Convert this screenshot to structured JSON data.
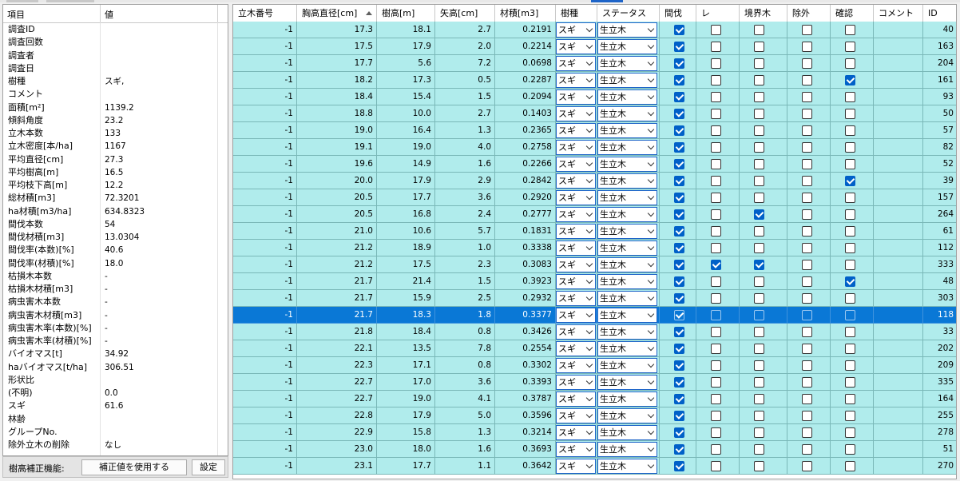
{
  "summary": {
    "header_item": "項目",
    "header_value": "値",
    "rows": [
      {
        "k": "調査ID",
        "v": ""
      },
      {
        "k": "調査回数",
        "v": ""
      },
      {
        "k": "調査者",
        "v": ""
      },
      {
        "k": "調査日",
        "v": ""
      },
      {
        "k": "樹種",
        "v": "スギ,"
      },
      {
        "k": "コメント",
        "v": ""
      },
      {
        "k": "面積[m²]",
        "v": "1139.2"
      },
      {
        "k": "傾斜角度",
        "v": "23.2"
      },
      {
        "k": "立木本数",
        "v": "133"
      },
      {
        "k": "立木密度[本/ha]",
        "v": "1167"
      },
      {
        "k": "平均直径[cm]",
        "v": "27.3"
      },
      {
        "k": "平均樹高[m]",
        "v": "16.5"
      },
      {
        "k": "平均枝下高[m]",
        "v": "12.2"
      },
      {
        "k": "総材積[m3]",
        "v": "72.3201"
      },
      {
        "k": "ha材積[m3/ha]",
        "v": "634.8323"
      },
      {
        "k": "間伐本数",
        "v": "54"
      },
      {
        "k": "間伐材積[m3]",
        "v": "13.0304"
      },
      {
        "k": "間伐率(本数)[%]",
        "v": "40.6"
      },
      {
        "k": "間伐率(材積)[%]",
        "v": "18.0"
      },
      {
        "k": "枯損木本数",
        "v": "-"
      },
      {
        "k": "枯損木材積[m3]",
        "v": "-"
      },
      {
        "k": "病虫害木本数",
        "v": "-"
      },
      {
        "k": "病虫害木材積[m3]",
        "v": "-"
      },
      {
        "k": "病虫害木率(本数)[%]",
        "v": "-"
      },
      {
        "k": "病虫害木率(材積)[%]",
        "v": "-"
      },
      {
        "k": "バイオマス[t]",
        "v": "34.92"
      },
      {
        "k": "haバイオマス[t/ha]",
        "v": "306.51"
      },
      {
        "k": "形状比",
        "v": ""
      },
      {
        "k": "  (不明)",
        "v": "0.0"
      },
      {
        "k": "  スギ",
        "v": "61.6"
      },
      {
        "k": "林齢",
        "v": ""
      },
      {
        "k": "グループNo.",
        "v": ""
      },
      {
        "k": "除外立木の削除",
        "v": "なし"
      }
    ]
  },
  "bottom": {
    "label": "樹高補正機能:",
    "use_corrected_button": "補正値を使用する",
    "settings_button": "設定"
  },
  "grid": {
    "columns": [
      "立木番号",
      "胸高直径[cm]",
      "樹高[m]",
      "矢高[cm]",
      "材積[m3]",
      "樹種",
      "ステータス",
      "間伐",
      "レ",
      "境界木",
      "除外",
      "確認",
      "コメント",
      "ID"
    ],
    "sorted_column": "胸高直径[cm]",
    "rows": [
      {
        "no": "-1",
        "dbh": "17.3",
        "h": "18.1",
        "ya": "2.7",
        "vol": "0.2191",
        "sp": "スギ",
        "st": "生立木",
        "th": true,
        "re": false,
        "bd": false,
        "ex": false,
        "ck": false,
        "id": "40"
      },
      {
        "no": "-1",
        "dbh": "17.5",
        "h": "17.9",
        "ya": "2.0",
        "vol": "0.2214",
        "sp": "スギ",
        "st": "生立木",
        "th": true,
        "re": false,
        "bd": false,
        "ex": false,
        "ck": false,
        "id": "163"
      },
      {
        "no": "-1",
        "dbh": "17.7",
        "h": "5.6",
        "ya": "7.2",
        "vol": "0.0698",
        "sp": "スギ",
        "st": "生立木",
        "th": true,
        "re": false,
        "bd": false,
        "ex": false,
        "ck": false,
        "id": "204"
      },
      {
        "no": "-1",
        "dbh": "18.2",
        "h": "17.3",
        "ya": "0.5",
        "vol": "0.2287",
        "sp": "スギ",
        "st": "生立木",
        "th": true,
        "re": false,
        "bd": false,
        "ex": false,
        "ck": true,
        "id": "161"
      },
      {
        "no": "-1",
        "dbh": "18.4",
        "h": "15.4",
        "ya": "1.5",
        "vol": "0.2094",
        "sp": "スギ",
        "st": "生立木",
        "th": true,
        "re": false,
        "bd": false,
        "ex": false,
        "ck": false,
        "id": "93"
      },
      {
        "no": "-1",
        "dbh": "18.8",
        "h": "10.0",
        "ya": "2.7",
        "vol": "0.1403",
        "sp": "スギ",
        "st": "生立木",
        "th": true,
        "re": false,
        "bd": false,
        "ex": false,
        "ck": false,
        "id": "50"
      },
      {
        "no": "-1",
        "dbh": "19.0",
        "h": "16.4",
        "ya": "1.3",
        "vol": "0.2365",
        "sp": "スギ",
        "st": "生立木",
        "th": true,
        "re": false,
        "bd": false,
        "ex": false,
        "ck": false,
        "id": "57"
      },
      {
        "no": "-1",
        "dbh": "19.1",
        "h": "19.0",
        "ya": "4.0",
        "vol": "0.2758",
        "sp": "スギ",
        "st": "生立木",
        "th": true,
        "re": false,
        "bd": false,
        "ex": false,
        "ck": false,
        "id": "82"
      },
      {
        "no": "-1",
        "dbh": "19.6",
        "h": "14.9",
        "ya": "1.6",
        "vol": "0.2266",
        "sp": "スギ",
        "st": "生立木",
        "th": true,
        "re": false,
        "bd": false,
        "ex": false,
        "ck": false,
        "id": "52"
      },
      {
        "no": "-1",
        "dbh": "20.0",
        "h": "17.9",
        "ya": "2.9",
        "vol": "0.2842",
        "sp": "スギ",
        "st": "生立木",
        "th": true,
        "re": false,
        "bd": false,
        "ex": false,
        "ck": true,
        "id": "39"
      },
      {
        "no": "-1",
        "dbh": "20.5",
        "h": "17.7",
        "ya": "3.6",
        "vol": "0.2920",
        "sp": "スギ",
        "st": "生立木",
        "th": true,
        "re": false,
        "bd": false,
        "ex": false,
        "ck": false,
        "id": "157"
      },
      {
        "no": "-1",
        "dbh": "20.5",
        "h": "16.8",
        "ya": "2.4",
        "vol": "0.2777",
        "sp": "スギ",
        "st": "生立木",
        "th": true,
        "re": false,
        "bd": true,
        "ex": false,
        "ck": false,
        "id": "264"
      },
      {
        "no": "-1",
        "dbh": "21.0",
        "h": "10.6",
        "ya": "5.7",
        "vol": "0.1831",
        "sp": "スギ",
        "st": "生立木",
        "th": true,
        "re": false,
        "bd": false,
        "ex": false,
        "ck": false,
        "id": "61"
      },
      {
        "no": "-1",
        "dbh": "21.2",
        "h": "18.9",
        "ya": "1.0",
        "vol": "0.3338",
        "sp": "スギ",
        "st": "生立木",
        "th": true,
        "re": false,
        "bd": false,
        "ex": false,
        "ck": false,
        "id": "112"
      },
      {
        "no": "-1",
        "dbh": "21.2",
        "h": "17.5",
        "ya": "2.3",
        "vol": "0.3083",
        "sp": "スギ",
        "st": "生立木",
        "th": true,
        "re": true,
        "bd": true,
        "ex": false,
        "ck": false,
        "id": "333"
      },
      {
        "no": "-1",
        "dbh": "21.7",
        "h": "21.4",
        "ya": "1.5",
        "vol": "0.3923",
        "sp": "スギ",
        "st": "生立木",
        "th": true,
        "re": false,
        "bd": false,
        "ex": false,
        "ck": true,
        "id": "48"
      },
      {
        "no": "-1",
        "dbh": "21.7",
        "h": "15.9",
        "ya": "2.5",
        "vol": "0.2932",
        "sp": "スギ",
        "st": "生立木",
        "th": true,
        "re": false,
        "bd": false,
        "ex": false,
        "ck": false,
        "id": "303"
      },
      {
        "no": "-1",
        "dbh": "21.7",
        "h": "18.3",
        "ya": "1.8",
        "vol": "0.3377",
        "sp": "スギ",
        "st": "生立木",
        "th": true,
        "re": false,
        "bd": false,
        "ex": false,
        "ck": false,
        "id": "118",
        "selected": true
      },
      {
        "no": "-1",
        "dbh": "21.8",
        "h": "18.4",
        "ya": "0.8",
        "vol": "0.3426",
        "sp": "スギ",
        "st": "生立木",
        "th": true,
        "re": false,
        "bd": false,
        "ex": false,
        "ck": false,
        "id": "33"
      },
      {
        "no": "-1",
        "dbh": "22.1",
        "h": "13.5",
        "ya": "7.8",
        "vol": "0.2554",
        "sp": "スギ",
        "st": "生立木",
        "th": true,
        "re": false,
        "bd": false,
        "ex": false,
        "ck": false,
        "id": "202"
      },
      {
        "no": "-1",
        "dbh": "22.3",
        "h": "17.1",
        "ya": "0.8",
        "vol": "0.3302",
        "sp": "スギ",
        "st": "生立木",
        "th": true,
        "re": false,
        "bd": false,
        "ex": false,
        "ck": false,
        "id": "209"
      },
      {
        "no": "-1",
        "dbh": "22.7",
        "h": "17.0",
        "ya": "3.6",
        "vol": "0.3393",
        "sp": "スギ",
        "st": "生立木",
        "th": true,
        "re": false,
        "bd": false,
        "ex": false,
        "ck": false,
        "id": "335"
      },
      {
        "no": "-1",
        "dbh": "22.7",
        "h": "19.0",
        "ya": "4.1",
        "vol": "0.3787",
        "sp": "スギ",
        "st": "生立木",
        "th": true,
        "re": false,
        "bd": false,
        "ex": false,
        "ck": false,
        "id": "164"
      },
      {
        "no": "-1",
        "dbh": "22.8",
        "h": "17.9",
        "ya": "5.0",
        "vol": "0.3596",
        "sp": "スギ",
        "st": "生立木",
        "th": true,
        "re": false,
        "bd": false,
        "ex": false,
        "ck": false,
        "id": "255"
      },
      {
        "no": "-1",
        "dbh": "22.9",
        "h": "15.8",
        "ya": "1.3",
        "vol": "0.3214",
        "sp": "スギ",
        "st": "生立木",
        "th": true,
        "re": false,
        "bd": false,
        "ex": false,
        "ck": false,
        "id": "278"
      },
      {
        "no": "-1",
        "dbh": "23.0",
        "h": "18.0",
        "ya": "1.6",
        "vol": "0.3693",
        "sp": "スギ",
        "st": "生立木",
        "th": true,
        "re": false,
        "bd": false,
        "ex": false,
        "ck": false,
        "id": "51"
      },
      {
        "no": "-1",
        "dbh": "23.1",
        "h": "17.7",
        "ya": "1.1",
        "vol": "0.3642",
        "sp": "スギ",
        "st": "生立木",
        "th": true,
        "re": false,
        "bd": false,
        "ex": false,
        "ck": false,
        "id": "270"
      }
    ]
  },
  "colors": {
    "row_bg": "#b0ecec",
    "selected_bg": "#0a78d6",
    "checkbox_on": "#0060c8"
  }
}
